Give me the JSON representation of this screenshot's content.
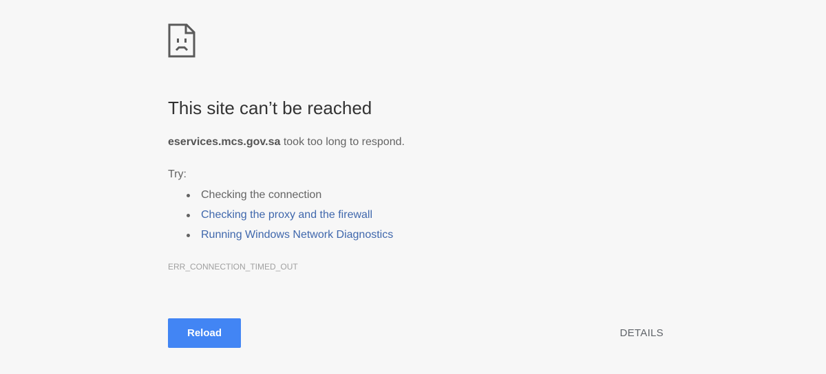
{
  "error_page": {
    "icon": "sad-page-icon",
    "title": "This site can’t be reached",
    "message": {
      "host": "eservices.mcs.gov.sa",
      "text": " took too long to respond."
    },
    "try_label": "Try:",
    "suggestions": [
      {
        "label": "Checking the connection",
        "is_link": false
      },
      {
        "label": "Checking the proxy and the firewall",
        "is_link": true
      },
      {
        "label": "Running Windows Network Diagnostics",
        "is_link": true
      }
    ],
    "error_code": "ERR_CONNECTION_TIMED_OUT",
    "reload_label": "Reload",
    "details_label": "DETAILS"
  },
  "colors": {
    "background": "#f7f7f7",
    "link": "#3f67ac",
    "primary_button": "#4285f4"
  }
}
